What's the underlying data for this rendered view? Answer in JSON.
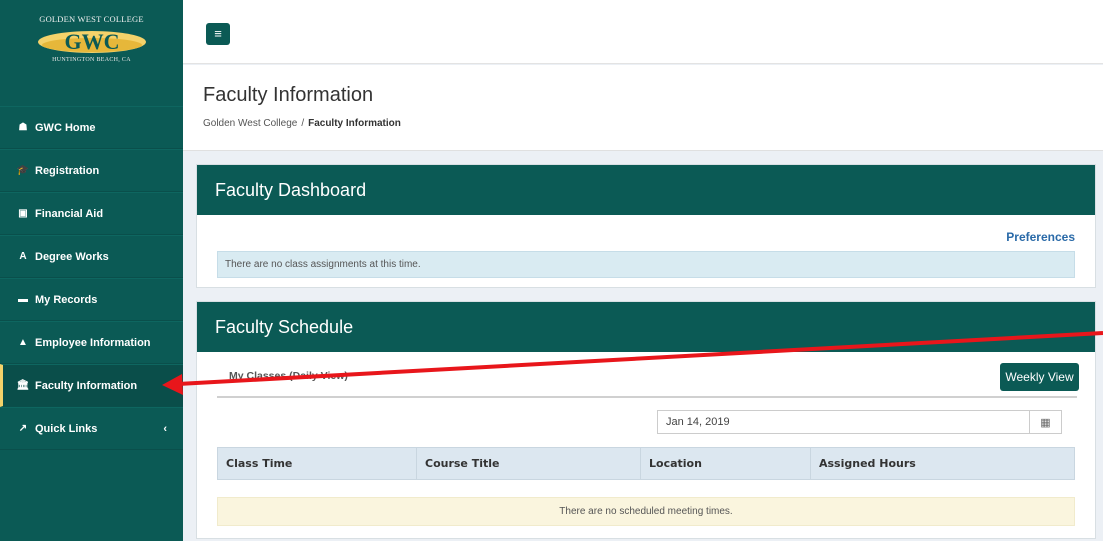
{
  "sidebar": {
    "logo": {
      "top_text": "GOLDEN WEST COLLEGE",
      "mark_text": "GWC",
      "bottom_text": "HUNTINGTON BEACH, CA",
      "accent_color": "#f4d26a"
    },
    "items": [
      {
        "label": "GWC Home",
        "icon": "home-icon",
        "glyph": "☗"
      },
      {
        "label": "Registration",
        "icon": "graduation-cap-icon",
        "glyph": "🎓"
      },
      {
        "label": "Financial Aid",
        "icon": "money-icon",
        "glyph": "▣"
      },
      {
        "label": "Degree Works",
        "icon": "font-a-icon",
        "glyph": "A"
      },
      {
        "label": "My Records",
        "icon": "folder-icon",
        "glyph": "▬"
      },
      {
        "label": "Employee Information",
        "icon": "user-icon",
        "glyph": "▲"
      },
      {
        "label": "Faculty Information",
        "icon": "institution-icon",
        "glyph": "🏛",
        "active": true
      },
      {
        "label": "Quick Links",
        "icon": "external-link-icon",
        "glyph": "↗",
        "caret": "‹"
      }
    ]
  },
  "topbar": {
    "menu_icon": "hamburger-icon",
    "menu_glyph": "≡"
  },
  "header": {
    "title": "Faculty Information",
    "breadcrumb": {
      "root": "Golden West College",
      "separator": "/",
      "current": "Faculty Information"
    }
  },
  "dashboard": {
    "title": "Faculty Dashboard",
    "preferences_link": "Preferences",
    "message": "There are no class assignments at this time."
  },
  "schedule": {
    "title": "Faculty Schedule",
    "tab_label": "My Classes (Daily View)",
    "weekly_button": "Weekly View",
    "date_value": "Jan 14, 2019",
    "calendar_icon": "calendar-icon",
    "columns": [
      "Class Time",
      "Course Title",
      "Location",
      "Assigned Hours"
    ],
    "empty_message": "There are no scheduled meeting times."
  },
  "colors": {
    "brand": "#0b5a55",
    "annotation_arrow": "#e8161b"
  }
}
